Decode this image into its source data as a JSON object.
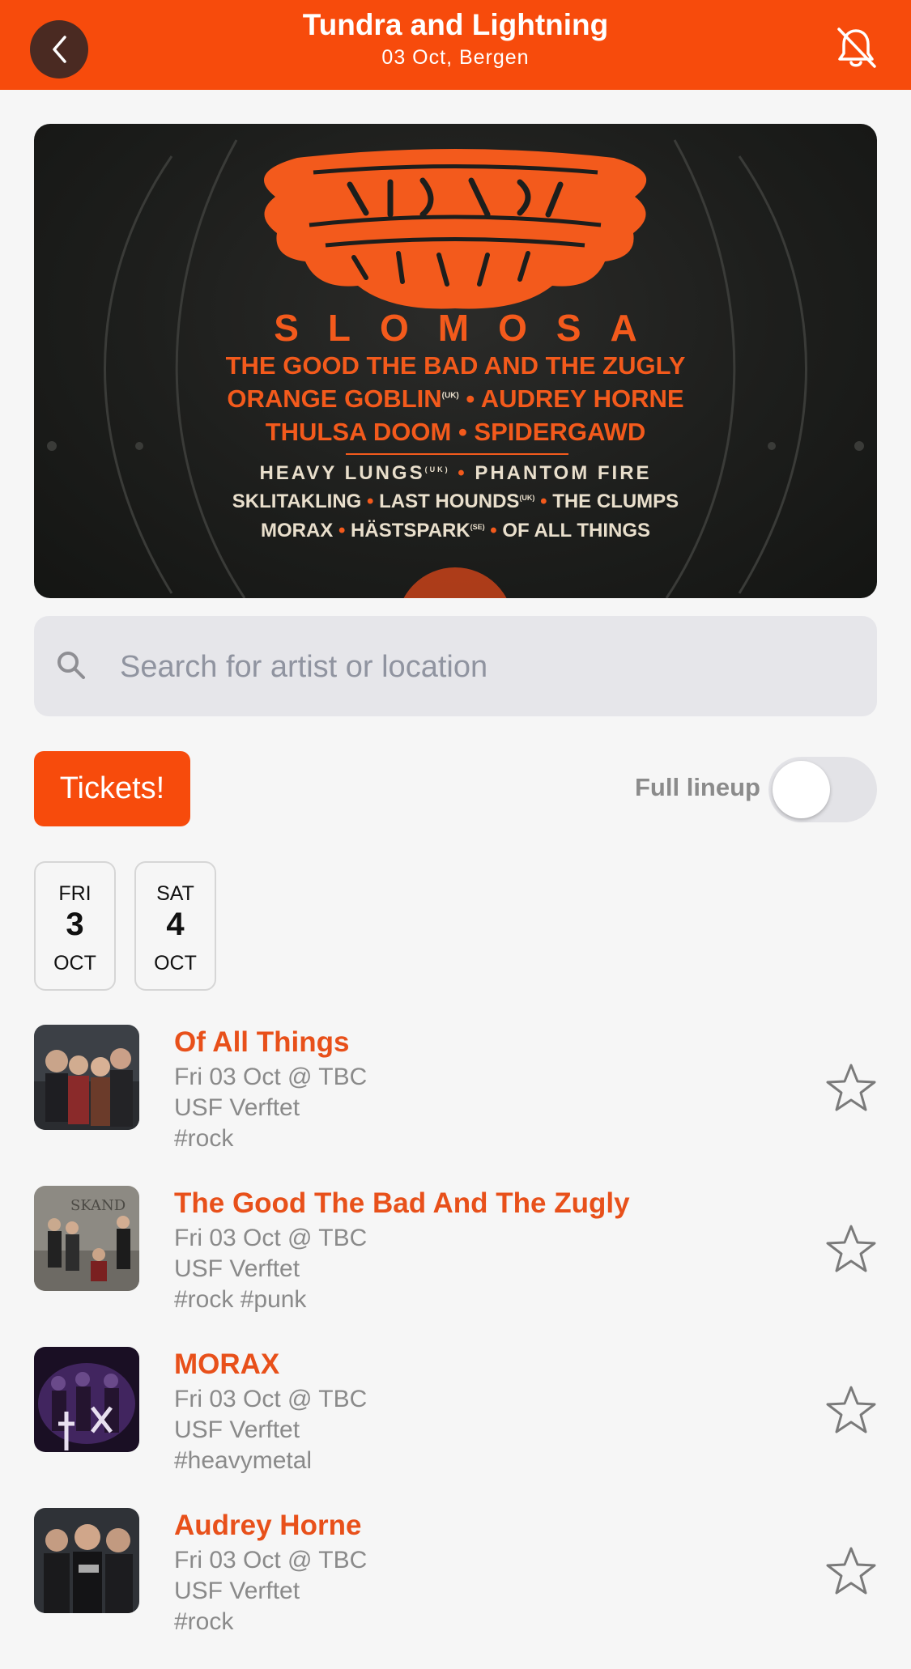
{
  "header": {
    "title": "Tundra and Lightning",
    "subtitle": "03 Oct, Bergen"
  },
  "poster": {
    "lines": [
      "SLOMOSA",
      "THE GOOD THE BAD AND THE ZUGLY",
      "ORANGE GOBLIN",
      "AUDREY HORNE",
      "THULSA DOOM",
      "SPIDERGAWD",
      "HEAVY LUNGS",
      "PHANTOM FIRE",
      "SKLITAKLING",
      "LAST HOUNDS",
      "THE CLUMPS",
      "MORAX",
      "HÄSTSPARK",
      "OF ALL THINGS"
    ],
    "tags": {
      "uk": "(UK)",
      "se": "(SE)"
    }
  },
  "search": {
    "placeholder": "Search for artist or location",
    "value": ""
  },
  "tickets_label": "Tickets!",
  "lineup_toggle": {
    "label": "Full lineup",
    "on": false
  },
  "days": [
    {
      "dow": "FRI",
      "num": "3",
      "mon": "OCT"
    },
    {
      "dow": "SAT",
      "num": "4",
      "mon": "OCT"
    }
  ],
  "artists": [
    {
      "name": "Of All Things",
      "when": "Fri 03 Oct @ TBC",
      "venue": "USF Verftet",
      "tags": "#rock"
    },
    {
      "name": "The Good The Bad And The Zugly",
      "when": "Fri 03 Oct @ TBC",
      "venue": "USF Verftet",
      "tags": "#rock #punk"
    },
    {
      "name": "MORAX",
      "when": "Fri 03 Oct @ TBC",
      "venue": "USF Verftet",
      "tags": "#heavymetal"
    },
    {
      "name": "Audrey Horne",
      "when": "Fri 03 Oct @ TBC",
      "venue": "USF Verftet",
      "tags": "#rock"
    }
  ],
  "icons": {
    "back": "chevron-left-icon",
    "bell": "bell-off-icon",
    "search": "search-icon",
    "star": "star-outline-icon"
  },
  "colors": {
    "accent": "#f74b0c",
    "artist_name": "#e8501a",
    "background": "#f6f6f6"
  }
}
